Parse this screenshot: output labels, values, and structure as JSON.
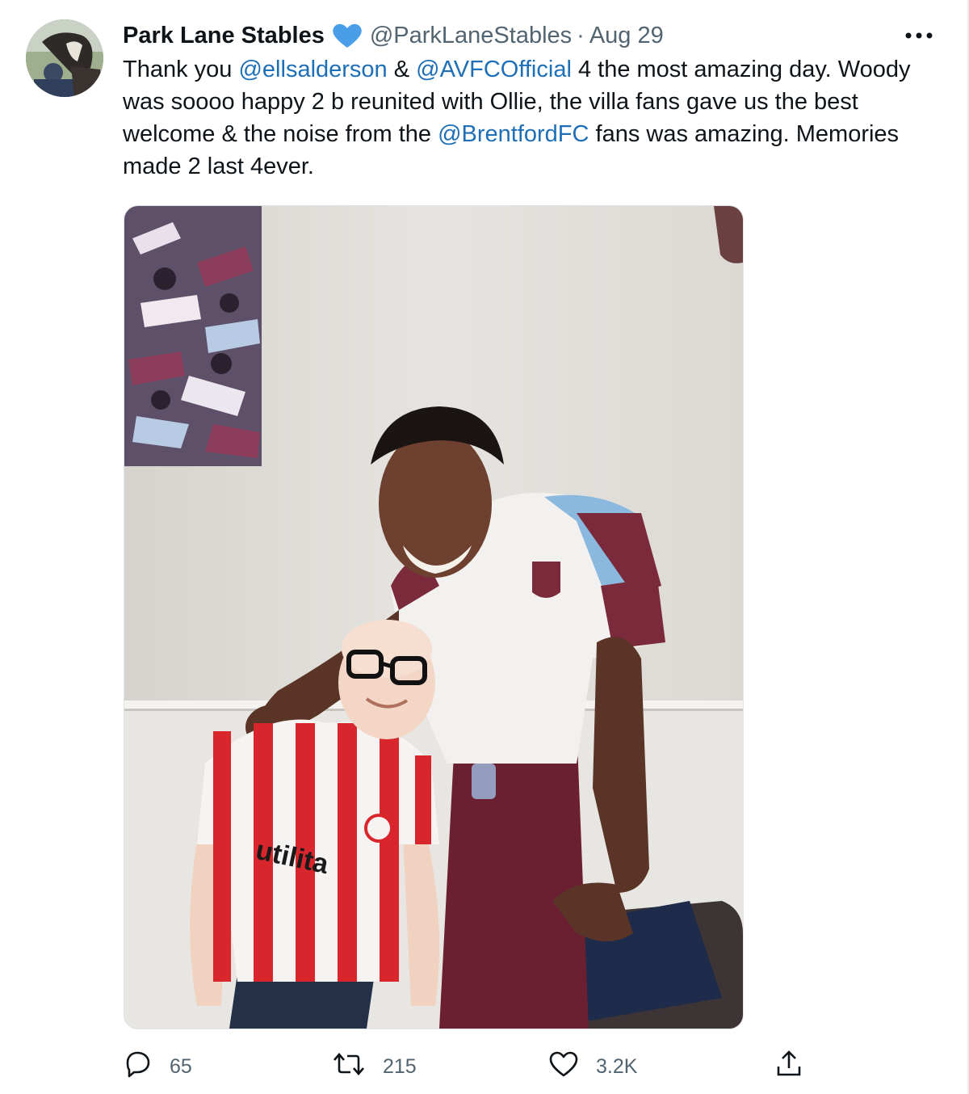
{
  "tweet": {
    "display_name": "Park Lane Stables",
    "verified_icon": "verified-badge-icon",
    "handle": "@ParkLaneStables",
    "separator": "·",
    "date": "Aug 29",
    "more_icon": "more-options-icon",
    "text": {
      "part1": "Thank you ",
      "mention1": "@ellsalderson",
      "part2": " & ",
      "mention2": "@AVFCOfficial",
      "part3": " 4 the most amazing day. Woody was soooo happy 2 b reunited with Ollie, the villa fans gave us the best welcome & the noise from the ",
      "mention3": "@BrentfordFC",
      "part4": " fans was amazing. Memories made 2 last 4ever."
    },
    "photo": {
      "kit_sponsor_text": "utilita",
      "colors": {
        "wall": "#e3e1dd",
        "brentford_red": "#d9252c",
        "villa_claret": "#7a2a3a",
        "villa_blue": "#8ab8de"
      }
    },
    "actions": {
      "reply": {
        "icon": "reply-icon",
        "count": "65"
      },
      "retweet": {
        "icon": "retweet-icon",
        "count": "215"
      },
      "like": {
        "icon": "heart-icon",
        "count": "3.2K"
      },
      "share": {
        "icon": "share-icon"
      }
    }
  },
  "theme": {
    "text": "#0f1419",
    "secondary_text": "#536471",
    "link": "#1d6fb8",
    "verified_blue": "#4a9ee8"
  }
}
